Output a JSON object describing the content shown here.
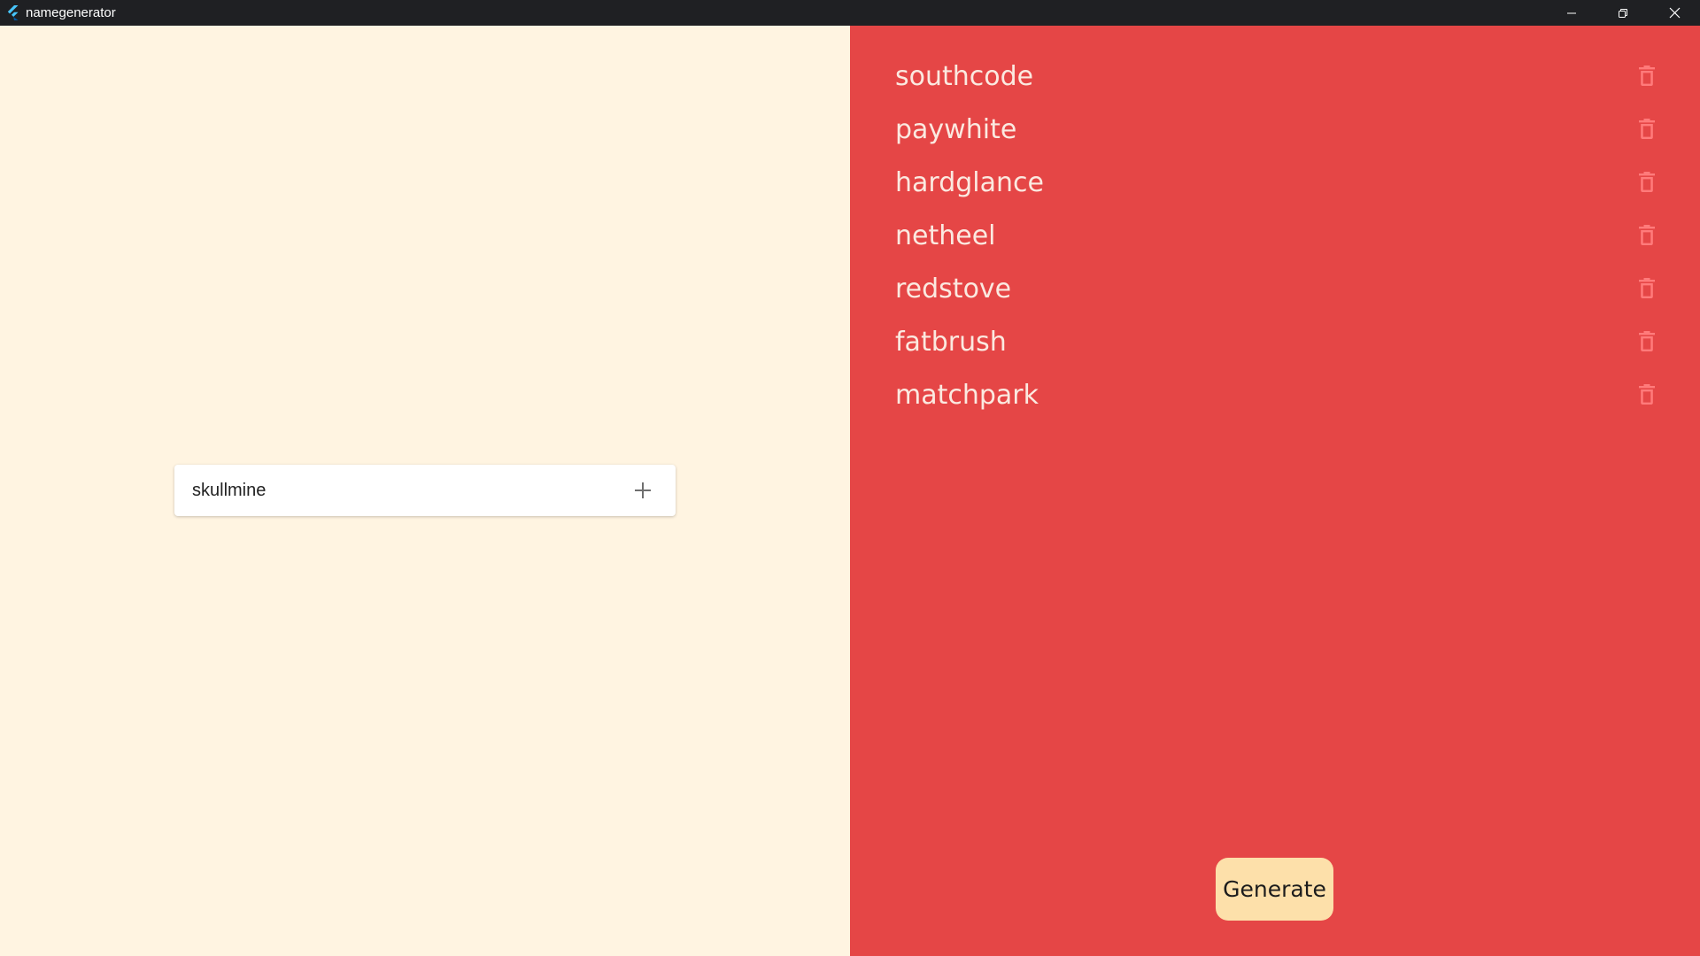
{
  "window": {
    "title": "namegenerator"
  },
  "input": {
    "value": "skullmine",
    "add_icon": "plus-icon"
  },
  "names": [
    {
      "label": "southcode"
    },
    {
      "label": "paywhite"
    },
    {
      "label": "hardglance"
    },
    {
      "label": "netheel"
    },
    {
      "label": "redstove"
    },
    {
      "label": "fatbrush"
    },
    {
      "label": "matchpark"
    }
  ],
  "actions": {
    "generate_label": "Generate"
  },
  "colors": {
    "left_bg": "#fff4e1",
    "right_bg": "#e54646",
    "button_bg": "#fde0aa",
    "delete_icon": "#ff7b7b",
    "titlebar": "#1f2023"
  }
}
